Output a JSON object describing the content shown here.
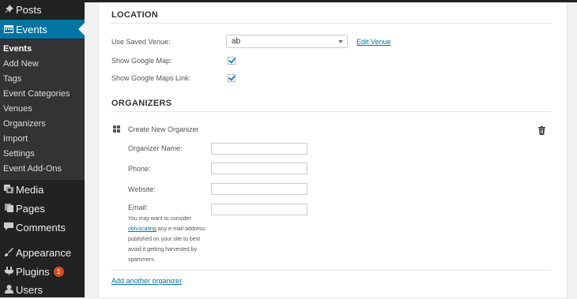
{
  "sidebar": {
    "top_items": [
      {
        "label": "Posts",
        "icon": "pin-icon"
      },
      {
        "label": "Events",
        "icon": "calendar-icon"
      }
    ],
    "submenu": [
      "Events",
      "Add New",
      "Tags",
      "Event Categories",
      "Venues",
      "Organizers",
      "Import",
      "Settings",
      "Event Add-Ons"
    ],
    "bottom_items": [
      {
        "label": "Media",
        "icon": "media-icon"
      },
      {
        "label": "Pages",
        "icon": "pages-icon"
      },
      {
        "label": "Comments",
        "icon": "comments-icon"
      },
      {
        "label": "Appearance",
        "icon": "appearance-icon"
      },
      {
        "label": "Plugins",
        "icon": "plugins-icon",
        "badge": "1"
      },
      {
        "label": "Users",
        "icon": "users-icon"
      }
    ]
  },
  "location": {
    "title": "LOCATION",
    "saved_venue_label": "Use Saved Venue:",
    "saved_venue_value": "ab",
    "edit_venue_link": "Edit Venue",
    "google_map_label": "Show Google Map:",
    "google_map_checked": true,
    "google_maps_link_label": "Show Google Maps Link:",
    "google_maps_link_checked": true
  },
  "organizers": {
    "title": "ORGANIZERS",
    "create_new_label": "Create New Organizer",
    "name_label": "Organizer Name:",
    "phone_label": "Phone:",
    "website_label": "Website:",
    "email_label": "Email:",
    "email_help_before": "You may want to consider ",
    "email_help_link": "obfuscating",
    "email_help_after": " any e-mail address published on your site to best avoid it getting harvested by spammers.",
    "add_another_link": "Add another organizer"
  },
  "colors": {
    "sidebar_bg": "#222222",
    "submenu_bg": "#333333",
    "active_menu": "#0074a2",
    "link": "#0074a2",
    "badge": "#d54e21"
  }
}
